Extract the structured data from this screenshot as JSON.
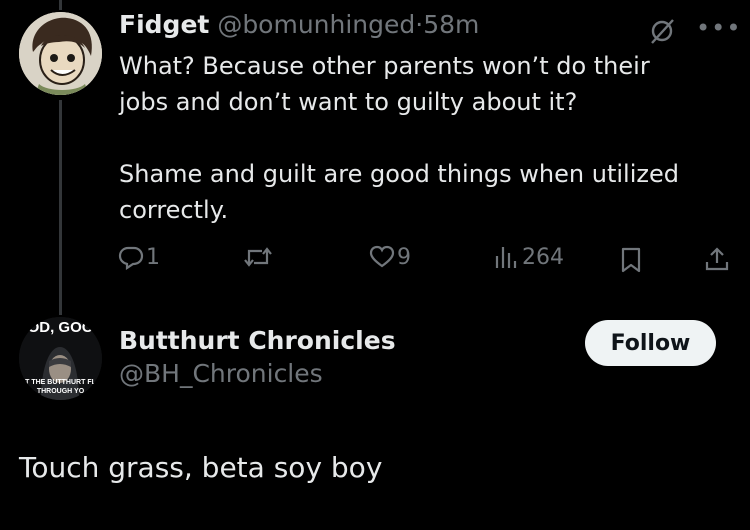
{
  "reply": {
    "display_name": "Fidget",
    "handle": "@bomunhinged",
    "separator": "·",
    "time": "58m",
    "text_line1": "What? Because other parents won’t do their",
    "text_line2": "jobs and don’t want to guilty about it?",
    "text_line3": "Shame and guilt are good things when utilized",
    "text_line4": "correctly.",
    "replies": "1",
    "likes": "9",
    "views": "264",
    "icons": [
      "grok-icon",
      "more-icon",
      "reply-icon",
      "retweet-icon",
      "like-icon",
      "views-icon",
      "bookmark-icon",
      "share-icon"
    ]
  },
  "main": {
    "display_name": "Butthurt Chronicles",
    "handle": "@BH_Chronicles",
    "follow_label": "Follow",
    "avatar_text_top": "OD, GOO",
    "avatar_text_bottom1": "T THE BUTTHURT FL",
    "avatar_text_bottom2": "THROUGH YO",
    "text": "Touch grass, beta soy boy"
  },
  "colors": {
    "background": "#000000",
    "text": "#e7e9ea",
    "muted": "#71767b",
    "follow_bg": "#eff3f4",
    "follow_text": "#0f1419"
  }
}
